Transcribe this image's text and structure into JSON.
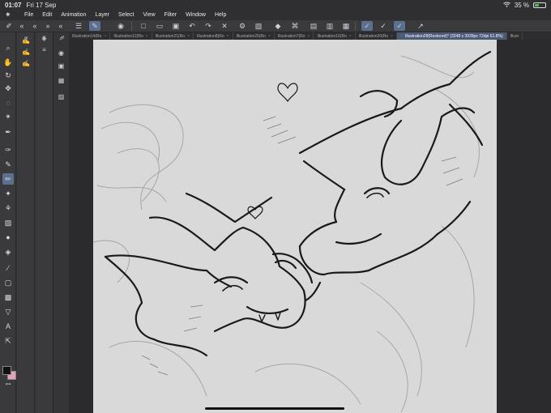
{
  "status_bar": {
    "time": "01:07",
    "date": "Fri 17 Sep",
    "battery_text": "35 %",
    "battery_level": 0.35,
    "battery_color": "#46c35b"
  },
  "menu": {
    "items": [
      "File",
      "Edit",
      "Animation",
      "Layer",
      "Select",
      "View",
      "Filter",
      "Window",
      "Help"
    ]
  },
  "tabs": [
    {
      "label": "Illustration14(Ro"
    },
    {
      "label": "Illustration12(Ro"
    },
    {
      "label": "Illustration21(Ro"
    },
    {
      "label": "Illustration8(Ro"
    },
    {
      "label": "Illustration25(Ro"
    },
    {
      "label": "Illustration7(Ro"
    },
    {
      "label": "Illustration16(Ro"
    },
    {
      "label": "Illustration20(Ro"
    },
    {
      "label": "Illustration28(Restored)* (3248 x 3939px 72dpi 61.8%)",
      "active": true
    },
    {
      "label": "Illust"
    }
  ],
  "colors": {
    "ui_bg": "#3a3a3c",
    "active_tool": "#5b6f8e",
    "canvas": "#d9d9d9",
    "main_color": "#111111",
    "sub_color": "#e8a0b4"
  },
  "icons": {
    "toolbox": [
      "zoom-icon",
      "hand-icon",
      "rotate-icon",
      "move-icon",
      "lasso-icon",
      "magic-wand-icon",
      "eyedropper-icon",
      "pen-icon",
      "pencil-icon",
      "brush-icon",
      "airbrush-icon",
      "decoration-icon",
      "eraser-icon",
      "blend-icon",
      "fill-icon",
      "gradient-icon",
      "figure-icon",
      "ruler-icon",
      "frame-icon",
      "text-icon",
      "balloon-icon",
      "correction-icon"
    ]
  }
}
